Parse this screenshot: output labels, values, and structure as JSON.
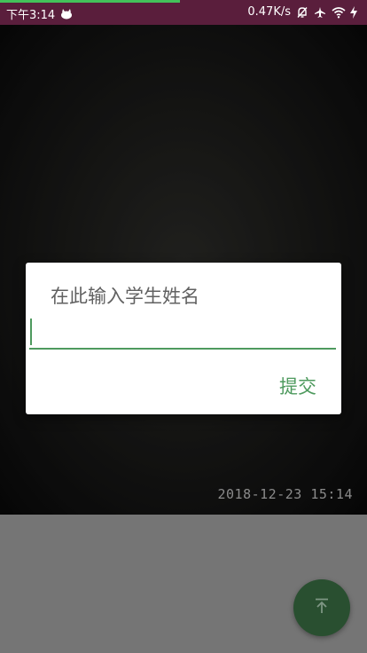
{
  "status_bar": {
    "time": "下午3:14",
    "network_speed": "0.47K/s",
    "progress_fraction": 0.49,
    "icons": [
      "notification-cat-icon",
      "mute-icon",
      "airplane-icon",
      "wifi-icon",
      "charging-icon"
    ],
    "background_color": "#5a1e3c",
    "progress_color": "#43c25a"
  },
  "photo": {
    "timestamp": "2018-12-23 15:14"
  },
  "dialog": {
    "title": "在此输入学生姓名",
    "input_value": "",
    "submit_label": "提交",
    "accent_color": "#4e9a5e"
  },
  "fab": {
    "icon": "arrow-up-to-top-icon",
    "color": "#294f30"
  }
}
